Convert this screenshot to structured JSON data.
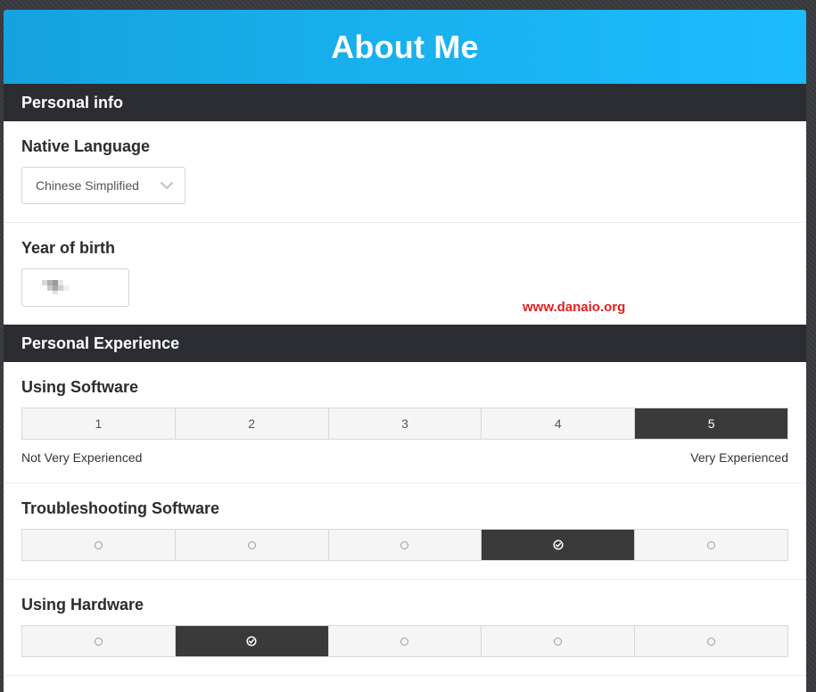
{
  "header": {
    "title": "About Me"
  },
  "sections": {
    "personal_info": "Personal info",
    "personal_experience": "Personal Experience"
  },
  "native_language": {
    "label": "Native Language",
    "value": "Chinese Simplified"
  },
  "year_of_birth": {
    "label": "Year of birth"
  },
  "watermark": "www.danaio.org",
  "using_software": {
    "label": "Using Software",
    "options": [
      "1",
      "2",
      "3",
      "4",
      "5"
    ],
    "selected": 5,
    "low_label": "Not Very Experienced",
    "high_label": "Very Experienced"
  },
  "troubleshooting_software": {
    "label": "Troubleshooting Software",
    "selected": 4
  },
  "using_hardware": {
    "label": "Using Hardware",
    "selected": 2
  },
  "colors": {
    "header_start": "#16a2de",
    "header_end": "#1bbcff",
    "section_bar": "#2b2d33",
    "selected_cell": "#3a3a3a",
    "watermark": "#e02020"
  }
}
